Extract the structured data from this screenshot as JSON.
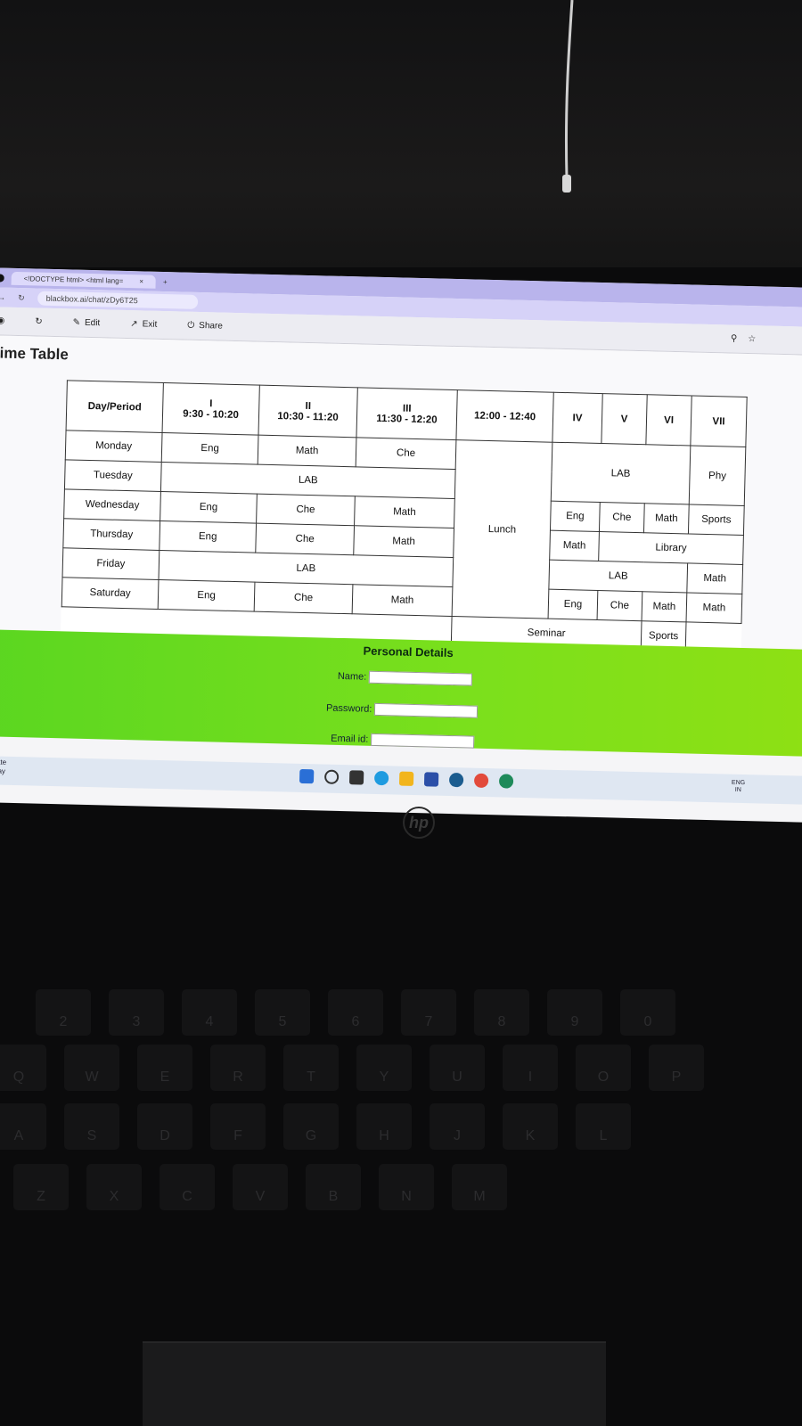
{
  "browser": {
    "tab_title": "<!DOCTYPE html> <html lang=",
    "tab_close": "×",
    "new_tab": "+",
    "url": "blackbox.ai/chat/zDy6T25"
  },
  "toolbar": {
    "edit_label": "Edit",
    "exit_label": "Exit",
    "share_label": "Share"
  },
  "page": {
    "title": "ime Table"
  },
  "timetable": {
    "header": {
      "day_period": "Day/Period",
      "p1_num": "I",
      "p1_time": "9:30 - 10:20",
      "p2_num": "II",
      "p2_time": "10:30 - 11:20",
      "p3_num": "III",
      "p3_time": "11:30 - 12:20",
      "lunch_time": "12:00 - 12:40",
      "p4": "IV",
      "p5": "V",
      "p6": "VI",
      "p7": "VII"
    },
    "monday": {
      "day": "Monday",
      "p1": "Eng",
      "p2": "Math",
      "p3": "Che"
    },
    "lunch_label": "Lunch",
    "tuesday": {
      "day": "Tuesday",
      "lab": "LAB",
      "lab2": "LAB",
      "p7": "Phy"
    },
    "wednesday": {
      "day": "Wednesday",
      "p1": "Eng",
      "p2": "Che",
      "p3": "Math",
      "p4": "Eng",
      "p5": "Che",
      "p6": "Math",
      "p7": "Sports"
    },
    "thursday": {
      "day": "Thursday",
      "p1": "Eng",
      "p2": "Che",
      "p3": "Math",
      "p4": "Math",
      "library": "Library"
    },
    "friday": {
      "day": "Friday",
      "lab": "LAB",
      "lab2": "LAB",
      "p7": "Math"
    },
    "saturday": {
      "day": "Saturday",
      "p1": "Eng",
      "p2": "Che",
      "p3": "Math",
      "p4": "Eng",
      "p5": "Che",
      "p6": "Math",
      "p7": "Math",
      "seminar": "Seminar",
      "sports": "Sports"
    }
  },
  "personal": {
    "title": "Personal Details",
    "name_label": "Name:",
    "password_label": "Password:",
    "email_label": "Email id:"
  },
  "taskbar": {
    "weather_line1": "derate",
    "weather_line2": "onday",
    "lang": "ENG",
    "region": "IN"
  },
  "laptop": {
    "brand": "hp"
  },
  "keyboard": {
    "row1": [
      "2",
      "3",
      "4",
      "5",
      "6",
      "7",
      "8",
      "9",
      "0"
    ],
    "row2": [
      "Q",
      "W",
      "E",
      "R",
      "T",
      "Y",
      "U",
      "I",
      "O",
      "P"
    ],
    "row3": [
      "A",
      "S",
      "D",
      "F",
      "G",
      "H",
      "J",
      "K",
      "L"
    ],
    "row4": [
      "Z",
      "X",
      "C",
      "V",
      "B",
      "N",
      "M"
    ]
  }
}
